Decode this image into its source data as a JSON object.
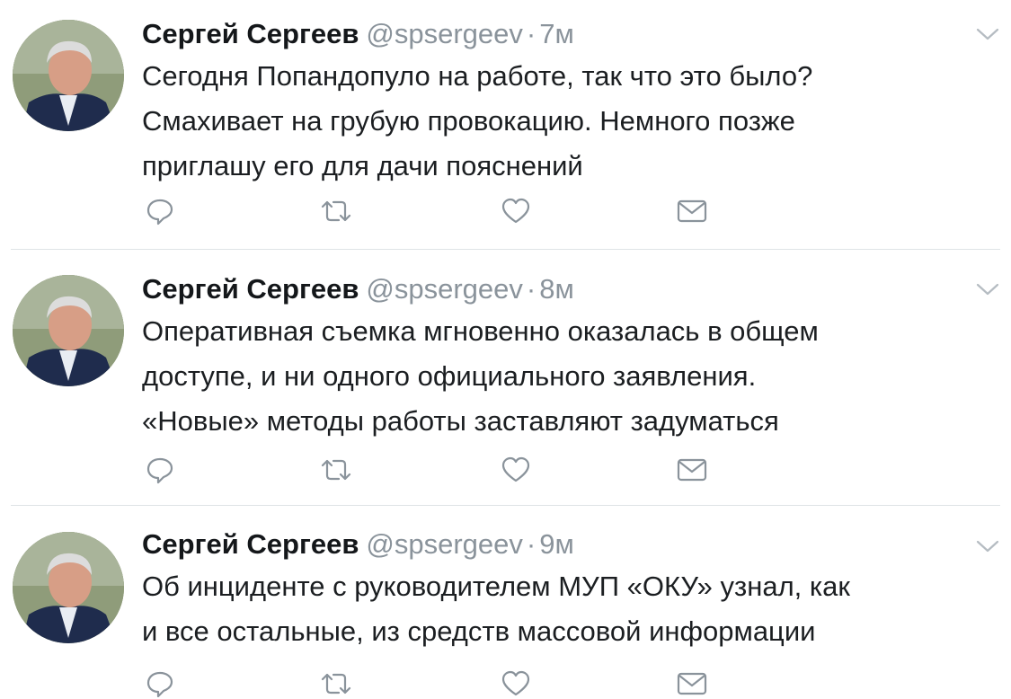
{
  "tweets": [
    {
      "name": "Сергей Сергеев",
      "handle": "@spsergeev",
      "dot": "·",
      "time": "7м",
      "text": "Сегодня Попандопуло на работе, так что это было?\nСмахивает на грубую провокацию. Немного позже\nприглашу его для дачи пояснений"
    },
    {
      "name": "Сергей Сергеев",
      "handle": "@spsergeev",
      "dot": "·",
      "time": "8м",
      "text": "Оперативная съемка мгновенно оказалась в общем\nдоступе, и ни одного официального заявления.\n«Новые» методы работы заставляют задуматься"
    },
    {
      "name": "Сергей Сергеев",
      "handle": "@spsergeev",
      "dot": "·",
      "time": "9м",
      "text": "Об инциденте с руководителем МУП «ОКУ» узнал, как\nи все остальные, из средств массовой информации"
    }
  ],
  "icons": {
    "reply": "reply-icon",
    "retweet": "retweet-icon",
    "like": "heart-icon",
    "dm": "envelope-icon",
    "menu": "chevron-down-icon"
  },
  "colors": {
    "name": "#14171a",
    "meta": "#8a939b",
    "icon": "#8a939b",
    "divider": "#dfe3e6"
  }
}
